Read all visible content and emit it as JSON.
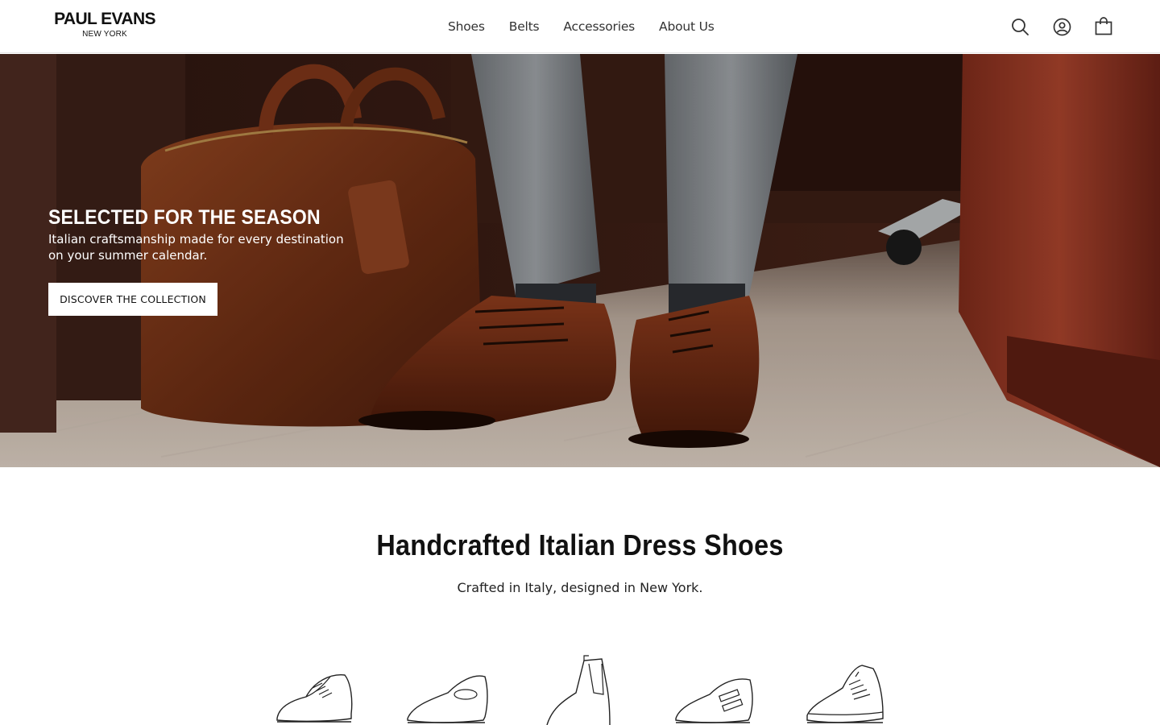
{
  "header": {
    "logo_main": "PAUL EVANS",
    "logo_sub": "NEW YORK",
    "nav": [
      {
        "label": "Shoes"
      },
      {
        "label": "Belts"
      },
      {
        "label": "Accessories"
      },
      {
        "label": "About Us"
      }
    ],
    "icons": [
      "search-icon",
      "account-icon",
      "cart-icon"
    ]
  },
  "hero": {
    "title": "SELECTED FOR THE SEASON",
    "subtitle": "Italian craftsmanship made for every destination on your summer calendar.",
    "button_label": "DISCOVER THE COLLECTION"
  },
  "section": {
    "title": "Handcrafted Italian Dress Shoes",
    "subtitle": "Crafted in Italy, designed in New York."
  },
  "categories": [
    {
      "icon": "oxford-shoe-icon"
    },
    {
      "icon": "loafer-icon"
    },
    {
      "icon": "chelsea-boot-icon"
    },
    {
      "icon": "monk-strap-icon"
    },
    {
      "icon": "sneaker-icon"
    }
  ],
  "colors": {
    "background": "#ffffff",
    "text": "#111111",
    "leather": "#7a3418",
    "wood": "#5a1d12"
  }
}
